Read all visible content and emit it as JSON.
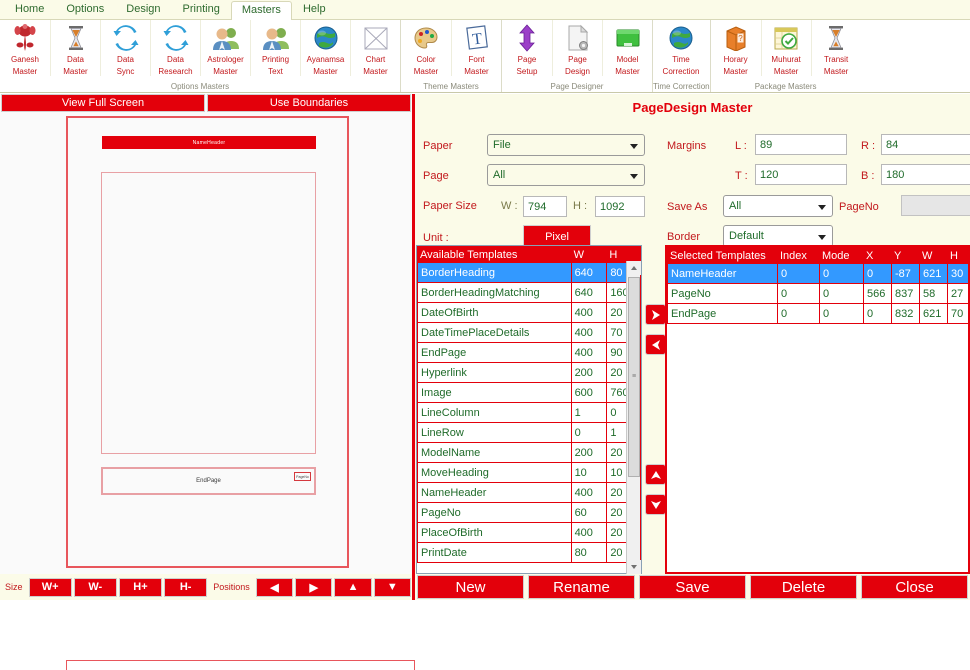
{
  "menu": {
    "items": [
      {
        "label": "Home",
        "active": false
      },
      {
        "label": "Options",
        "active": false
      },
      {
        "label": "Design",
        "active": false
      },
      {
        "label": "Printing",
        "active": false
      },
      {
        "label": "Masters",
        "active": true
      },
      {
        "label": "Help",
        "active": false
      }
    ]
  },
  "ribbon": {
    "groups": [
      {
        "label": "Options Masters",
        "buttons": [
          {
            "line1": "Ganesh",
            "line2": "Master",
            "icon": "ganesh-icon"
          },
          {
            "line1": "Data",
            "line2": "Master",
            "icon": "hourglass-icon"
          },
          {
            "line1": "Data",
            "line2": "Sync",
            "icon": "sync-icon"
          },
          {
            "line1": "Data",
            "line2": "Research",
            "icon": "sync-icon"
          },
          {
            "line1": "Astrologer",
            "line2": "Master",
            "icon": "people-icon"
          },
          {
            "line1": "Printing",
            "line2": "Text",
            "icon": "people-icon"
          },
          {
            "line1": "Ayanamsa",
            "line2": "Master",
            "icon": "globe-icon"
          },
          {
            "line1": "Chart",
            "line2": "Master",
            "icon": "chart-square-icon"
          }
        ]
      },
      {
        "label": "Theme Masters",
        "buttons": [
          {
            "line1": "Color",
            "line2": "Master",
            "icon": "palette-icon"
          },
          {
            "line1": "Font",
            "line2": "Master",
            "icon": "font-icon"
          }
        ]
      },
      {
        "label": "Page Designer",
        "buttons": [
          {
            "line1": "Page",
            "line2": "Setup",
            "icon": "updown-arrow-icon"
          },
          {
            "line1": "Page",
            "line2": "Design",
            "icon": "page-gear-icon"
          },
          {
            "line1": "Model",
            "line2": "Master",
            "icon": "green-box-icon"
          }
        ]
      },
      {
        "label": "Time Correction",
        "buttons": [
          {
            "line1": "Time",
            "line2": "Correction",
            "icon": "globe-icon"
          }
        ]
      },
      {
        "label": "Package Masters",
        "buttons": [
          {
            "line1": "Horary",
            "line2": "Master",
            "icon": "orange-box-icon"
          },
          {
            "line1": "Muhurat",
            "line2": "Master",
            "icon": "calendar-clock-icon"
          },
          {
            "line1": "Transit",
            "line2": "Master",
            "icon": "hourglass-icon"
          }
        ]
      }
    ]
  },
  "preview": {
    "view_full_screen": "View Full Screen",
    "use_boundaries": "Use Boundaries",
    "name_header": "NameHeader",
    "end_page": "EndPage",
    "page_no": "PageNo"
  },
  "bottom_left": {
    "size_label": "Size",
    "positions_label": "Positions",
    "size_buttons": [
      "W+",
      "W-",
      "H+",
      "H-"
    ],
    "position_buttons": [
      "◀",
      "▶",
      "▲",
      "▼"
    ]
  },
  "panel": {
    "title": "PageDesign Master",
    "paper_label": "Paper",
    "paper_value": "File",
    "page_label": "Page",
    "page_value": "All",
    "paper_size_label": "Paper Size",
    "w_label": "W :",
    "w_value": "794",
    "h_label": "H :",
    "h_value": "1092",
    "unit_label": "Unit :",
    "unit_value": "Pixel",
    "margins_label": "Margins",
    "left_label": "L :",
    "left_value": "89",
    "right_label": "R :",
    "right_value": "84",
    "top_label": "T :",
    "top_value": "120",
    "bottom_label": "B :",
    "bottom_value": "180",
    "save_as_label": "Save As",
    "save_as_value": "All",
    "page_no_label": "PageNo",
    "page_no_value": "",
    "border_label": "Border",
    "border_value": "Default"
  },
  "available": {
    "headers": [
      "Available Templates",
      "W",
      "H"
    ],
    "rows": [
      {
        "name": "BorderHeading",
        "w": "640",
        "h": "80",
        "selected": true
      },
      {
        "name": "BorderHeadingMatching",
        "w": "640",
        "h": "160",
        "selected": false
      },
      {
        "name": "DateOfBirth",
        "w": "400",
        "h": "20",
        "selected": false
      },
      {
        "name": "DateTimePlaceDetails",
        "w": "400",
        "h": "70",
        "selected": false
      },
      {
        "name": "EndPage",
        "w": "400",
        "h": "90",
        "selected": false
      },
      {
        "name": "Hyperlink",
        "w": "200",
        "h": "20",
        "selected": false
      },
      {
        "name": "Image",
        "w": "600",
        "h": "760",
        "selected": false
      },
      {
        "name": "LineColumn",
        "w": "1",
        "h": "0",
        "selected": false
      },
      {
        "name": "LineRow",
        "w": "0",
        "h": "1",
        "selected": false
      },
      {
        "name": "ModelName",
        "w": "200",
        "h": "20",
        "selected": false
      },
      {
        "name": "MoveHeading",
        "w": "10",
        "h": "10",
        "selected": false
      },
      {
        "name": "NameHeader",
        "w": "400",
        "h": "20",
        "selected": false
      },
      {
        "name": "PageNo",
        "w": "60",
        "h": "20",
        "selected": false
      },
      {
        "name": "PlaceOfBirth",
        "w": "400",
        "h": "20",
        "selected": false
      },
      {
        "name": "PrintDate",
        "w": "80",
        "h": "20",
        "selected": false
      }
    ]
  },
  "selected": {
    "headers": [
      "Selected Templates",
      "Index",
      "Mode",
      "X",
      "Y",
      "W",
      "H"
    ],
    "rows": [
      {
        "name": "NameHeader",
        "index": "0",
        "mode": "0",
        "x": "0",
        "y": "-87",
        "w": "621",
        "h": "30",
        "selected": true
      },
      {
        "name": "PageNo",
        "index": "0",
        "mode": "0",
        "x": "566",
        "y": "837",
        "w": "58",
        "h": "27",
        "selected": false
      },
      {
        "name": "EndPage",
        "index": "0",
        "mode": "0",
        "x": "0",
        "y": "832",
        "w": "621",
        "h": "70",
        "selected": false
      }
    ]
  },
  "move_buttons": [
    {
      "name": "add-right",
      "glyph": "➤"
    },
    {
      "name": "remove-left",
      "glyph": "➤"
    },
    {
      "name": "move-up",
      "glyph": "➤"
    },
    {
      "name": "move-down",
      "glyph": "➤"
    }
  ],
  "actions": {
    "buttons": [
      "New",
      "Rename",
      "Save",
      "Delete",
      "Close"
    ]
  },
  "colors": {
    "accent_red": "#e3000b",
    "menu_green": "#2f6b2f",
    "cell_green": "#1f6b2a",
    "select_blue": "#3399ff",
    "panel_bg": "#fbfbe8"
  }
}
